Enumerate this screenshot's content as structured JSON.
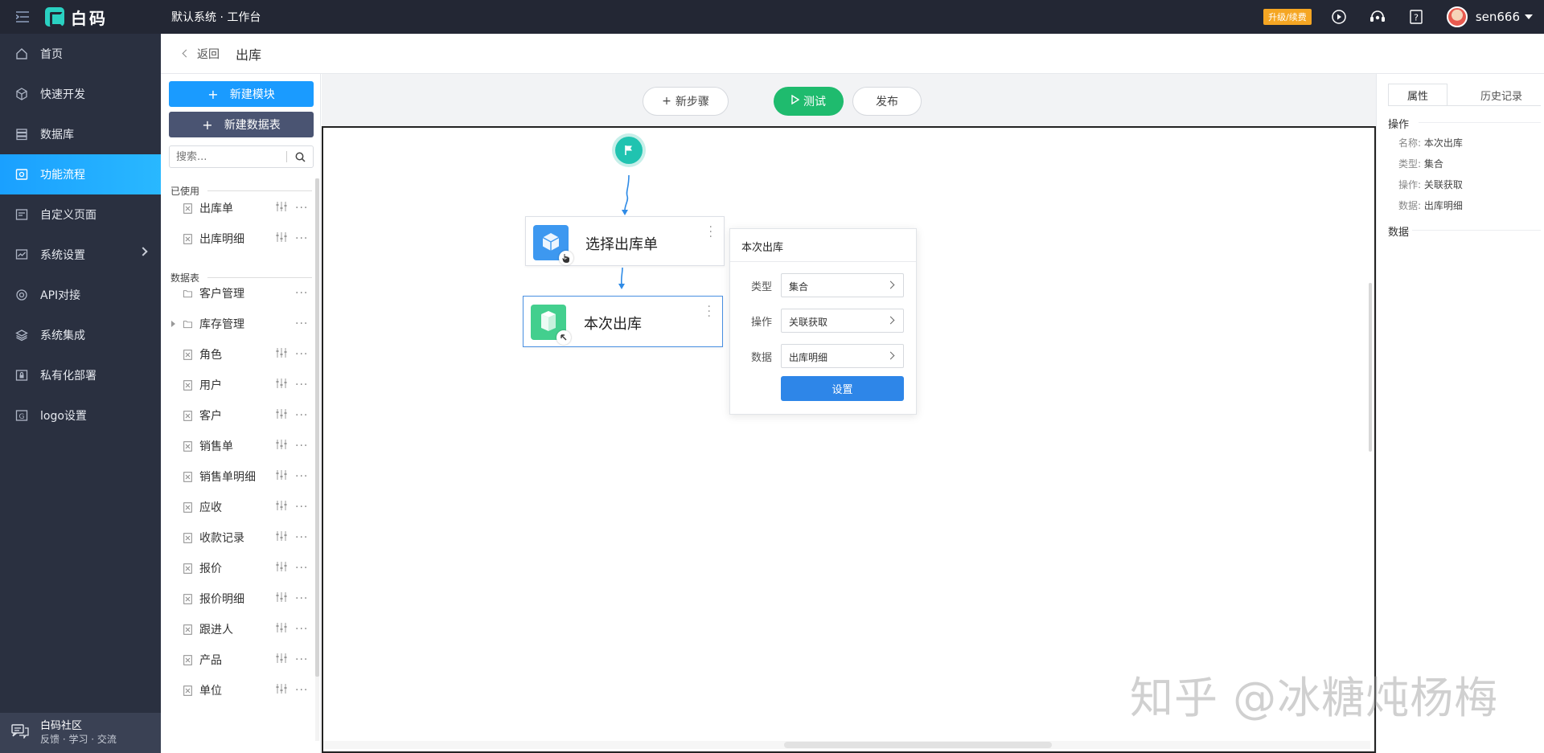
{
  "app": {
    "logo_text": "白码",
    "title": "默认系统 · 工作台",
    "upgrade_label": "升级/续费",
    "user_name": "sen666",
    "accent": "#1a9bff"
  },
  "sidebar": {
    "items": [
      {
        "label": "首页",
        "icon": "home-icon"
      },
      {
        "label": "快速开发",
        "icon": "cube-icon"
      },
      {
        "label": "数据库",
        "icon": "database-icon"
      },
      {
        "label": "功能流程",
        "icon": "flow-icon",
        "active": true
      },
      {
        "label": "自定义页面",
        "icon": "page-icon"
      },
      {
        "label": "系统设置",
        "icon": "chart-icon",
        "has_submenu": true
      },
      {
        "label": "API对接",
        "icon": "api-icon"
      },
      {
        "label": "系统集成",
        "icon": "layers-icon"
      },
      {
        "label": "私有化部署",
        "icon": "lock-icon"
      },
      {
        "label": "logo设置",
        "icon": "logo-icon"
      }
    ],
    "community": {
      "title": "白码社区",
      "subtitle": "反馈 · 学习 · 交流"
    }
  },
  "breadcrumb": {
    "back_label": "返回",
    "title": "出库"
  },
  "modules": {
    "new_module_label": "新建模块",
    "new_table_label": "新建数据表",
    "search_placeholder": "搜索...",
    "used_group_label": "已使用",
    "used_items": [
      "出库单",
      "出库明细"
    ],
    "tables_group_label": "数据表",
    "folders": [
      "客户管理",
      "库存管理"
    ],
    "table_items": [
      "角色",
      "用户",
      "客户",
      "销售单",
      "销售单明细",
      "应收",
      "收款记录",
      "报价",
      "报价明细",
      "跟进人",
      "产品",
      "单位"
    ]
  },
  "toolbar": {
    "new_step_label": "新步骤",
    "test_label": "测试",
    "publish_label": "发布"
  },
  "flow": {
    "nodes": [
      {
        "label": "选择出库单"
      },
      {
        "label": "本次出库"
      }
    ]
  },
  "popover": {
    "title": "本次出库",
    "type_label": "类型",
    "type_value": "集合",
    "operation_label": "操作",
    "operation_value": "关联获取",
    "data_label": "数据",
    "data_value": "出库明细",
    "settings_label": "设置"
  },
  "properties": {
    "tab_properties": "属性",
    "tab_history": "历史记录",
    "section_operation": "操作",
    "name_label": "名称:",
    "name_value": "本次出库",
    "type_label": "类型:",
    "type_value": "集合",
    "operation_label": "操作:",
    "operation_value": "关联获取",
    "data_label": "数据:",
    "data_value": "出库明细",
    "section_data": "数据"
  },
  "watermark": "知乎 @冰糖炖杨梅"
}
